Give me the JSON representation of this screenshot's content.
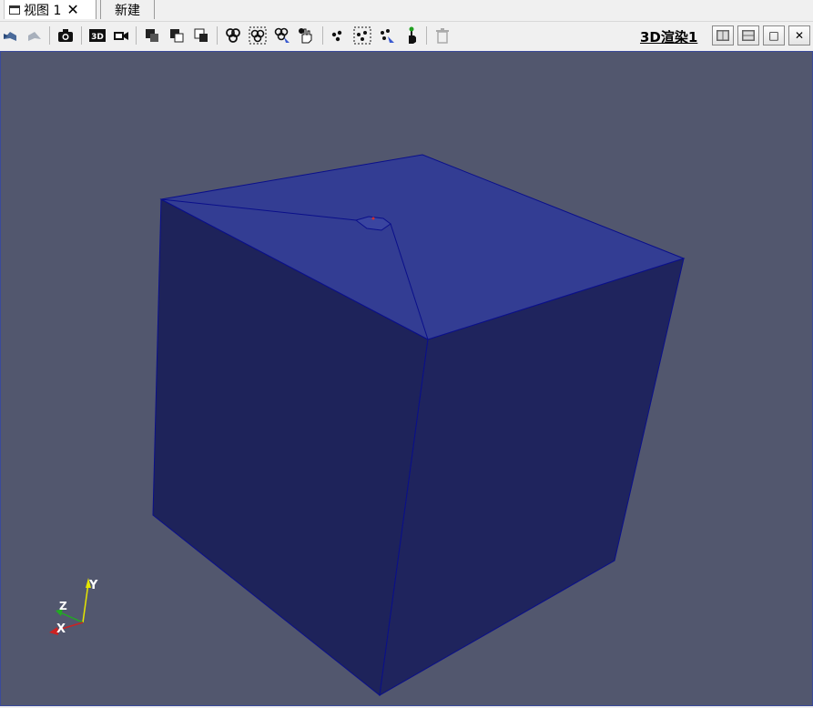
{
  "tabs": [
    {
      "label": "视图 1",
      "close_glyph": "✕",
      "active": true
    },
    {
      "label": "新建",
      "active": false
    }
  ],
  "toolbar": {
    "icons": [
      "undo-camera-icon",
      "redo-camera-icon",
      "camera-capture-icon",
      "3d-toggle-icon",
      "record-icon",
      "reset-view-icon",
      "zoom-box-icon",
      "orient-icon",
      "select-cells-on-icon",
      "select-cells-frustum-icon",
      "interactive-select-cells-icon",
      "grab-select-icon",
      "select-points-on-icon",
      "select-points-frustum-icon",
      "interactive-select-points-icon",
      "hover-points-icon",
      "clear-selection-icon"
    ],
    "render_label": "3D渲染1",
    "window_buttons": [
      {
        "name": "split-horizontal-button",
        "glyph": ""
      },
      {
        "name": "split-vertical-button",
        "glyph": ""
      },
      {
        "name": "maximize-button",
        "glyph": "□"
      },
      {
        "name": "close-view-button",
        "glyph": "✕"
      }
    ]
  },
  "viewport": {
    "background": "#52576e",
    "cube_top_color": "#333d93",
    "cube_left_color": "#1e235a",
    "cube_right_color": "#1f245d",
    "edge_color": "#0a0f8a"
  },
  "axes": {
    "x": "X",
    "y": "Y",
    "z": "Z",
    "x_color": "#cc2222",
    "y_color": "#e6e600",
    "z_color": "#22aa22"
  }
}
